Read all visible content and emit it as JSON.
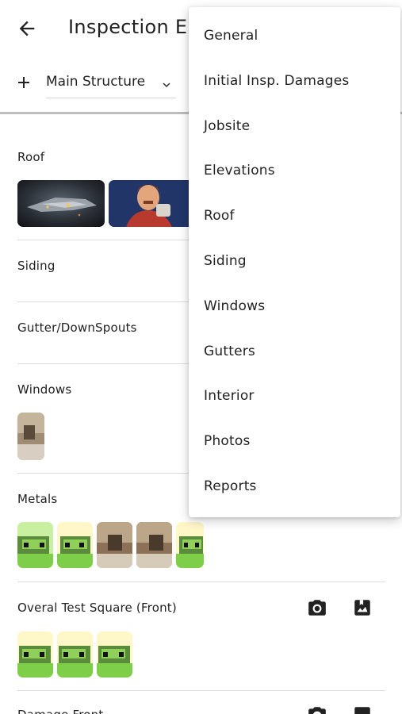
{
  "appbar": {
    "title": "Inspection E"
  },
  "subbar": {
    "structure": "Main Structure"
  },
  "sections": [
    {
      "title": "Roof"
    },
    {
      "title": "Siding"
    },
    {
      "title": "Gutter/DownSpouts"
    },
    {
      "title": "Windows"
    },
    {
      "title": "Metals"
    },
    {
      "title": "Overal Test Square (Front)"
    },
    {
      "title": "Damage Front"
    }
  ],
  "menu": {
    "items": [
      {
        "label": "General"
      },
      {
        "label": "Initial Insp. Damages"
      },
      {
        "label": "Jobsite"
      },
      {
        "label": "Elevations"
      },
      {
        "label": "Roof"
      },
      {
        "label": "Siding"
      },
      {
        "label": "Windows"
      },
      {
        "label": "Gutters"
      },
      {
        "label": "Interior"
      },
      {
        "label": "Photos"
      },
      {
        "label": "Reports"
      }
    ]
  },
  "colors": {
    "accent": "#222222",
    "menu_bg": "#ffffff",
    "divider": "#dcdcdc"
  }
}
